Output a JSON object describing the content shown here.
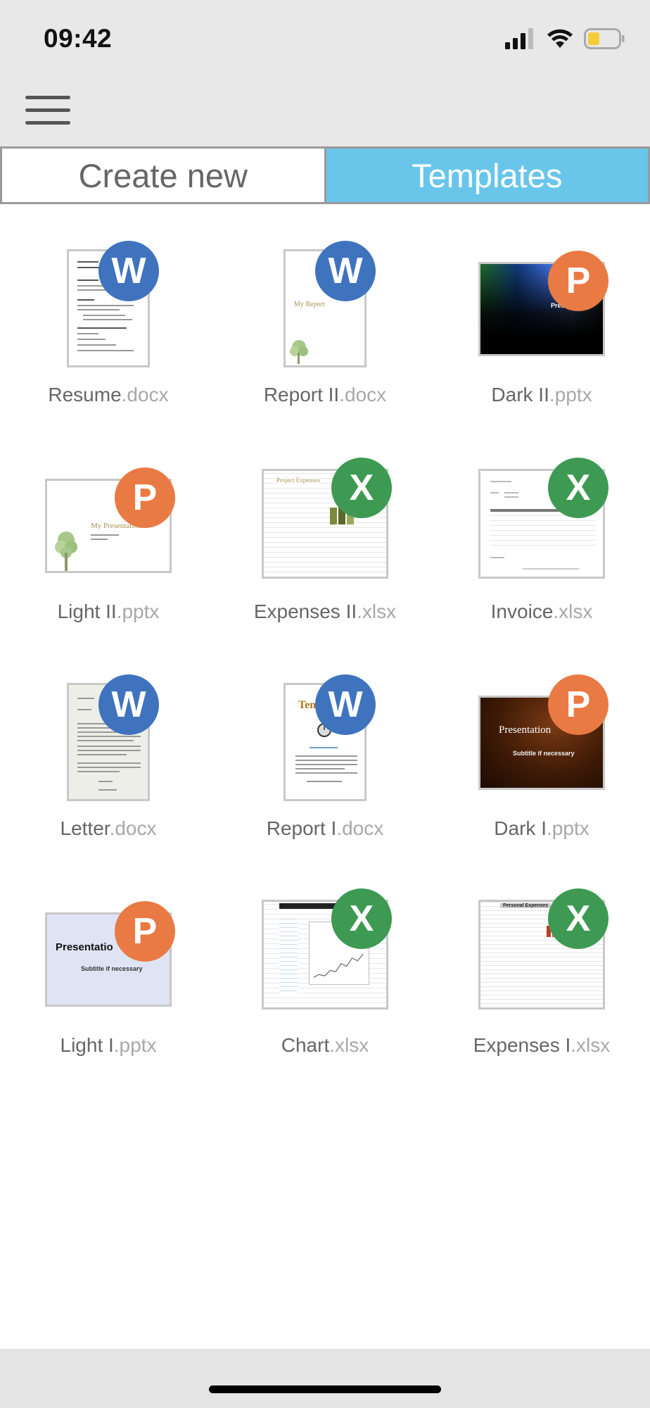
{
  "status_bar": {
    "time": "09:42",
    "signal_icon": "cellular-signal-icon",
    "wifi_icon": "wifi-icon",
    "battery_icon": "battery-low-icon"
  },
  "header": {
    "menu_icon": "hamburger-menu-icon"
  },
  "tabs": {
    "create_new": "Create new",
    "templates": "Templates",
    "active": "templates"
  },
  "colors": {
    "active_tab": "#69c5ea",
    "word_badge": "#3f73be",
    "powerpoint_badge": "#e97a44",
    "excel_badge": "#3e9a52"
  },
  "templates": [
    {
      "name": "Resume",
      "ext": ".docx",
      "badge": "W",
      "kind": "word"
    },
    {
      "name": "Report II",
      "ext": ".docx",
      "badge": "W",
      "kind": "word"
    },
    {
      "name": "Dark II",
      "ext": ".pptx",
      "badge": "P",
      "kind": "powerpoint"
    },
    {
      "name": "Light II",
      "ext": ".pptx",
      "badge": "P",
      "kind": "powerpoint"
    },
    {
      "name": "Expenses II",
      "ext": ".xlsx",
      "badge": "X",
      "kind": "excel"
    },
    {
      "name": "Invoice",
      "ext": ".xlsx",
      "badge": "X",
      "kind": "excel"
    },
    {
      "name": "Letter",
      "ext": ".docx",
      "badge": "W",
      "kind": "word"
    },
    {
      "name": "Report I",
      "ext": ".docx",
      "badge": "W",
      "kind": "word"
    },
    {
      "name": "Dark I",
      "ext": ".pptx",
      "badge": "P",
      "kind": "powerpoint"
    },
    {
      "name": "Light I",
      "ext": ".pptx",
      "badge": "P",
      "kind": "powerpoint"
    },
    {
      "name": "Chart",
      "ext": ".xlsx",
      "badge": "X",
      "kind": "excel"
    },
    {
      "name": "Expenses I",
      "ext": ".xlsx",
      "badge": "X",
      "kind": "excel"
    }
  ],
  "thumbnails": {
    "report2_title": "My Report",
    "light2_title": "My Presentation",
    "expenses2_title": "Project Expenses",
    "report1_title": "Tem",
    "dark1_title": "Presentation",
    "dark1_subtitle": "Subtitle if necessary",
    "light1_title": "Presentatio",
    "light1_subtitle": "Subtitle if necessary",
    "dark2_title": "Prese",
    "expenses1_title": "Personal Expenses"
  }
}
